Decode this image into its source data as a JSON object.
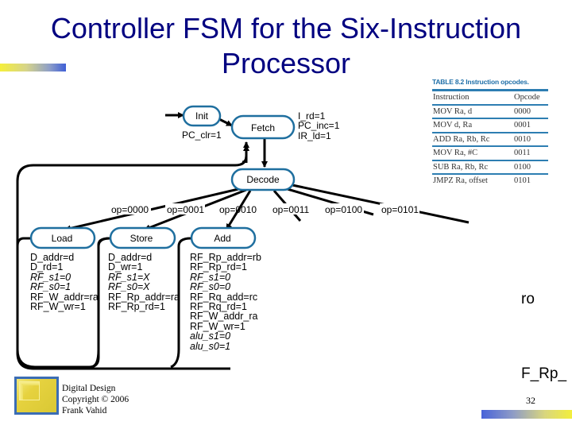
{
  "slide": {
    "title_line1": "Controller FSM for the Six-Instruction",
    "title_line2": "Processor",
    "page_number": "32",
    "accent_color": "#000080"
  },
  "fsm": {
    "states": {
      "init": "Init",
      "fetch": "Fetch",
      "decode": "Decode",
      "load": "Load",
      "store": "Store",
      "add": "Add"
    },
    "init_actions": [
      "PC_clr=1"
    ],
    "fetch_actions": [
      "I_rd=1",
      "PC_inc=1",
      "IR_ld=1"
    ],
    "transitions": [
      "op=0000",
      "op=0001",
      "op=0010",
      "op=0011",
      "op=0100",
      "op=0101"
    ],
    "load_actions": [
      {
        "text": "D_addr=d",
        "italic": false
      },
      {
        "text": "D_rd=1",
        "italic": false
      },
      {
        "text": "RF_s1=0",
        "italic": true
      },
      {
        "text": "RF_s0=1",
        "italic": true
      },
      {
        "text": "RF_W_addr=ra",
        "italic": false
      },
      {
        "text": "RF_W_wr=1",
        "italic": false
      }
    ],
    "store_actions": [
      {
        "text": "D_addr=d",
        "italic": false
      },
      {
        "text": "D_wr=1",
        "italic": false
      },
      {
        "text": "RF_s1=X",
        "italic": true
      },
      {
        "text": "RF_s0=X",
        "italic": true
      },
      {
        "text": "RF_Rp_addr=ra",
        "italic": false
      },
      {
        "text": "RF_Rp_rd=1",
        "italic": false
      }
    ],
    "add_actions": [
      {
        "text": "RF_Rp_addr=rb",
        "italic": false
      },
      {
        "text": "RF_Rp_rd=1",
        "italic": false
      },
      {
        "text": "RF_s1=0",
        "italic": true
      },
      {
        "text": "RF_s0=0",
        "italic": true
      },
      {
        "text": "RF_Rq_add=rc",
        "italic": false
      },
      {
        "text": "RF_Rq_rd=1",
        "italic": false
      },
      {
        "text": "RF_W_addr_ra",
        "italic": false
      },
      {
        "text": "RF_W_wr=1",
        "italic": false
      },
      {
        "text": "alu_s1=0",
        "italic": true
      },
      {
        "text": "alu_s0=1",
        "italic": true
      }
    ]
  },
  "opcode_table": {
    "caption": "TABLE 8.2  Instruction opcodes.",
    "headers": [
      "Instruction",
      "Opcode"
    ],
    "rows": [
      [
        "MOV Ra, d",
        "0000"
      ],
      [
        "MOV d, Ra",
        "0001"
      ],
      [
        "ADD Ra, Rb, Rc",
        "0010"
      ],
      [
        "MOV Ra, #C",
        "0011"
      ],
      [
        "SUB Ra, Rb, Rc",
        "0100"
      ],
      [
        "JMPZ Ra, offset",
        "0101"
      ]
    ]
  },
  "fragments": {
    "right_text_1": "ro",
    "right_text_2": "F_Rp_"
  },
  "footer": {
    "line1": "Digital Design",
    "line2": "Copyright © 2006",
    "line3": "Frank Vahid"
  }
}
